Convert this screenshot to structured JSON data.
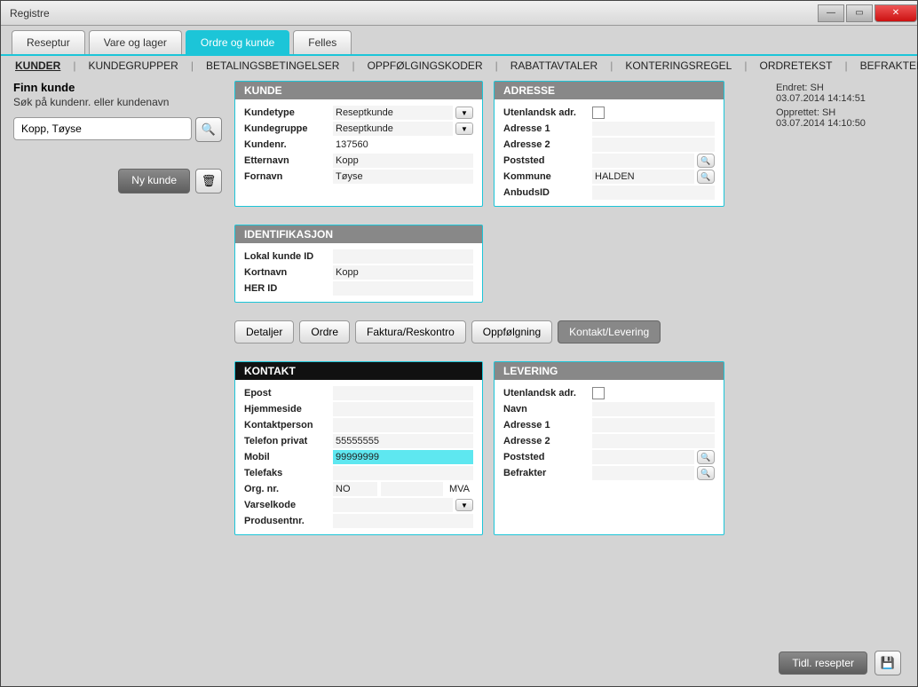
{
  "window": {
    "title": "Registre"
  },
  "mainTabs": {
    "t0": "Reseptur",
    "t1": "Vare og lager",
    "t2": "Ordre og kunde",
    "t3": "Felles"
  },
  "subnav": {
    "s0": "KUNDER",
    "s1": "KUNDEGRUPPER",
    "s2": "BETALINGSBETINGELSER",
    "s3": "OPPFØLGINGSKODER",
    "s4": "RABATTAVTALER",
    "s5": "KONTERINGSREGEL",
    "s6": "ORDRETEKST",
    "s7": "BEFRAKTERE"
  },
  "search": {
    "title": "Finn kunde",
    "subtitle": "Søk på kundenr. eller kundenavn",
    "value": "Kopp, Tøyse",
    "newCustomer": "Ny kunde"
  },
  "metadata": {
    "endretLabel": "Endret: SH",
    "endretTime": "03.07.2014 14:14:51",
    "opprettetLabel": "Opprettet: SH",
    "opprettetTime": "03.07.2014 14:10:50"
  },
  "kunde": {
    "header": "KUNDE",
    "kundetypeL": "Kundetype",
    "kundetype": "Reseptkunde",
    "kundegruppeL": "Kundegruppe",
    "kundegruppe": "Reseptkunde",
    "kundenrL": "Kundenr.",
    "kundenr": "137560",
    "etternavnL": "Etternavn",
    "etternavn": "Kopp",
    "fornavnL": "Fornavn",
    "fornavn": "Tøyse"
  },
  "adresse": {
    "header": "ADRESSE",
    "utenlandskL": "Utenlandsk adr.",
    "adr1L": "Adresse 1",
    "adr2L": "Adresse 2",
    "poststedL": "Poststed",
    "kommuneL": "Kommune",
    "kommune": "HALDEN",
    "anbudsL": "AnbudsID"
  },
  "ident": {
    "header": "IDENTIFIKASJON",
    "lokalL": "Lokal kunde ID",
    "kortnavnL": "Kortnavn",
    "kortnavn": "Kopp",
    "herL": "HER ID"
  },
  "subtabs": {
    "t0": "Detaljer",
    "t1": "Ordre",
    "t2": "Faktura/Reskontro",
    "t3": "Oppfølgning",
    "t4": "Kontakt/Levering"
  },
  "kontakt": {
    "header": "KONTAKT",
    "epostL": "Epost",
    "hjemmesideL": "Hjemmeside",
    "kontaktpersonL": "Kontaktperson",
    "telefonL": "Telefon privat",
    "telefon": "55555555",
    "mobilL": "Mobil",
    "mobil": "99999999",
    "telefaksL": "Telefaks",
    "orgL": "Org. nr.",
    "org1": "NO",
    "org2": "MVA",
    "varselL": "Varselkode",
    "prodL": "Produsentnr."
  },
  "levering": {
    "header": "LEVERING",
    "utenlandskL": "Utenlandsk adr.",
    "navnL": "Navn",
    "adr1L": "Adresse 1",
    "adr2L": "Adresse 2",
    "poststedL": "Poststed",
    "befrakterL": "Befrakter"
  },
  "footer": {
    "tidl": "Tidl. resepter"
  }
}
